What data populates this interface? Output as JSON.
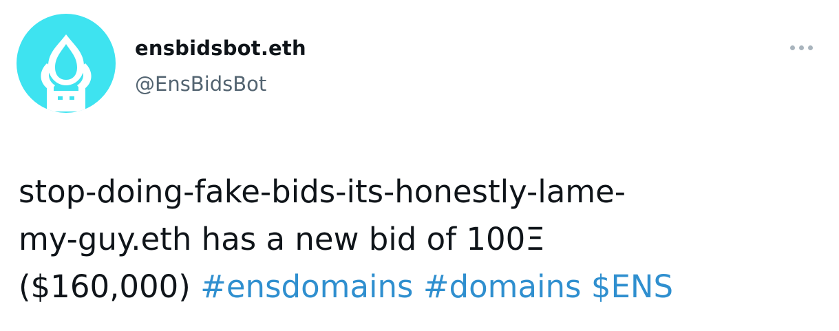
{
  "author": {
    "display_name": "ensbidsbot.eth",
    "handle": "@EnsBidsBot",
    "avatar_icon": "ens-bot-avatar-icon",
    "avatar_color": "#3ee3f0"
  },
  "more_icon": "more-horizontal-icon",
  "tweet": {
    "line1": "stop-doing-fake-bids-its-honestly-lame-",
    "line2": "my-guy.eth has a new bid of 100Ξ",
    "line3_text": "($160,000)",
    "hashtags": [
      "#ensdomains",
      "#domains"
    ],
    "cashtag": "$ENS"
  },
  "colors": {
    "link": "#2f8fcf",
    "text": "#0f1419",
    "secondary": "#536471"
  }
}
